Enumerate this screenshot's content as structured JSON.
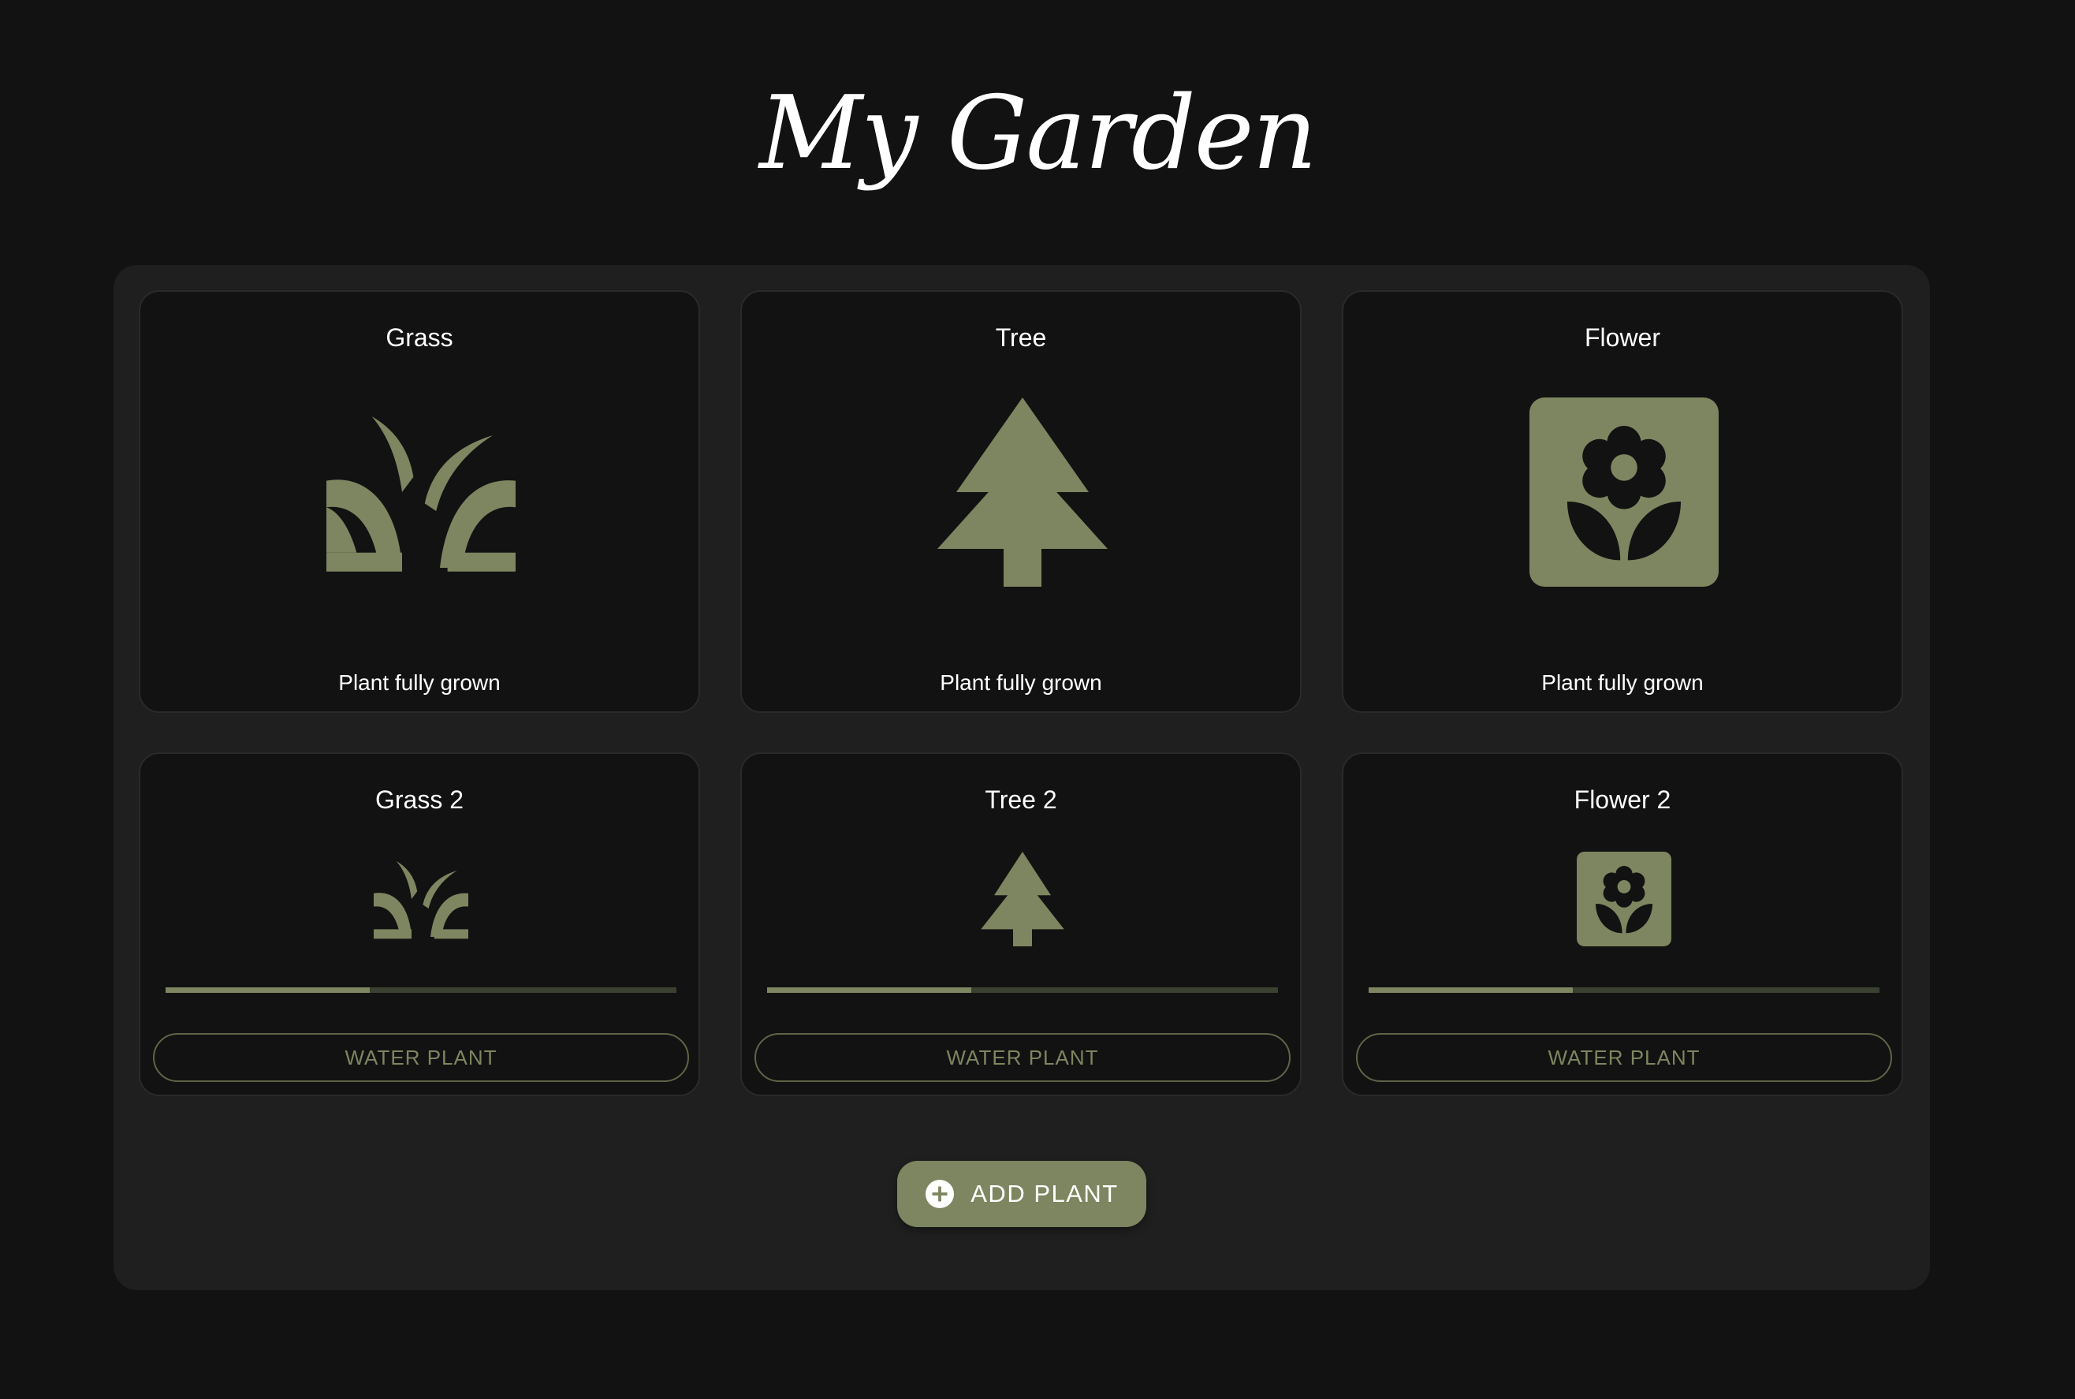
{
  "header": {
    "title": "My Garden"
  },
  "colors": {
    "background": "#121212",
    "panel": "#1f1f1f",
    "card": "#121212",
    "accent": "#7d8660",
    "progress_track": "#3a4130",
    "text": "#ffffff"
  },
  "plants": [
    {
      "name": "Grass",
      "icon": "grass-icon",
      "status": "Plant fully grown"
    },
    {
      "name": "Tree",
      "icon": "tree-icon",
      "status": "Plant fully grown"
    },
    {
      "name": "Flower",
      "icon": "flower-icon",
      "status": "Plant fully grown"
    },
    {
      "name": "Grass 2",
      "icon": "grass-icon",
      "growth_progress": 0.4,
      "action_label": "WATER PLANT"
    },
    {
      "name": "Tree 2",
      "icon": "tree-icon",
      "growth_progress": 0.4,
      "action_label": "WATER PLANT"
    },
    {
      "name": "Flower 2",
      "icon": "flower-icon",
      "growth_progress": 0.4,
      "action_label": "WATER PLANT"
    }
  ],
  "add_button": {
    "label": "ADD PLANT",
    "icon": "plus-circle-icon"
  }
}
